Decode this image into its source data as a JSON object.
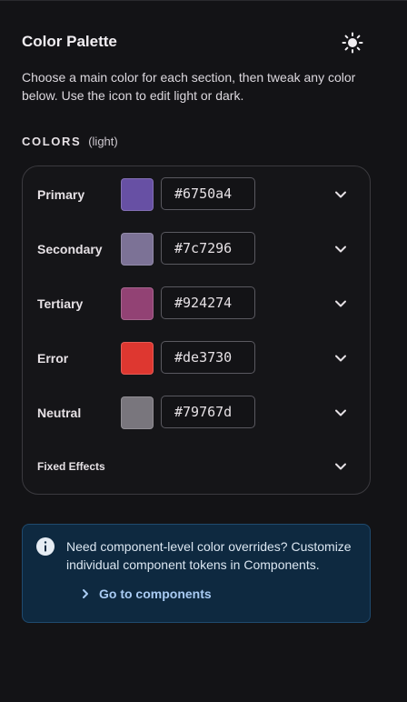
{
  "header": {
    "title": "Color Palette",
    "theme_icon": "sun-icon"
  },
  "description": "Choose a main color for each section, then tweak any color below. Use the icon to edit light or dark.",
  "section": {
    "label": "COLORS",
    "mode": "(light)"
  },
  "colors": [
    {
      "label": "Primary",
      "hex": "#6750a4",
      "swatch": "#6750a4"
    },
    {
      "label": "Secondary",
      "hex": "#7c7296",
      "swatch": "#7c7296"
    },
    {
      "label": "Tertiary",
      "hex": "#924274",
      "swatch": "#924274"
    },
    {
      "label": "Error",
      "hex": "#de3730",
      "swatch": "#de3730"
    },
    {
      "label": "Neutral",
      "hex": "#79767d",
      "swatch": "#79767d"
    }
  ],
  "fixed_effects": {
    "label": "Fixed Effects"
  },
  "info": {
    "icon": "info-icon",
    "text": "Need component-level color overrides? Customize individual component tokens in Components.",
    "link": "Go to components"
  }
}
